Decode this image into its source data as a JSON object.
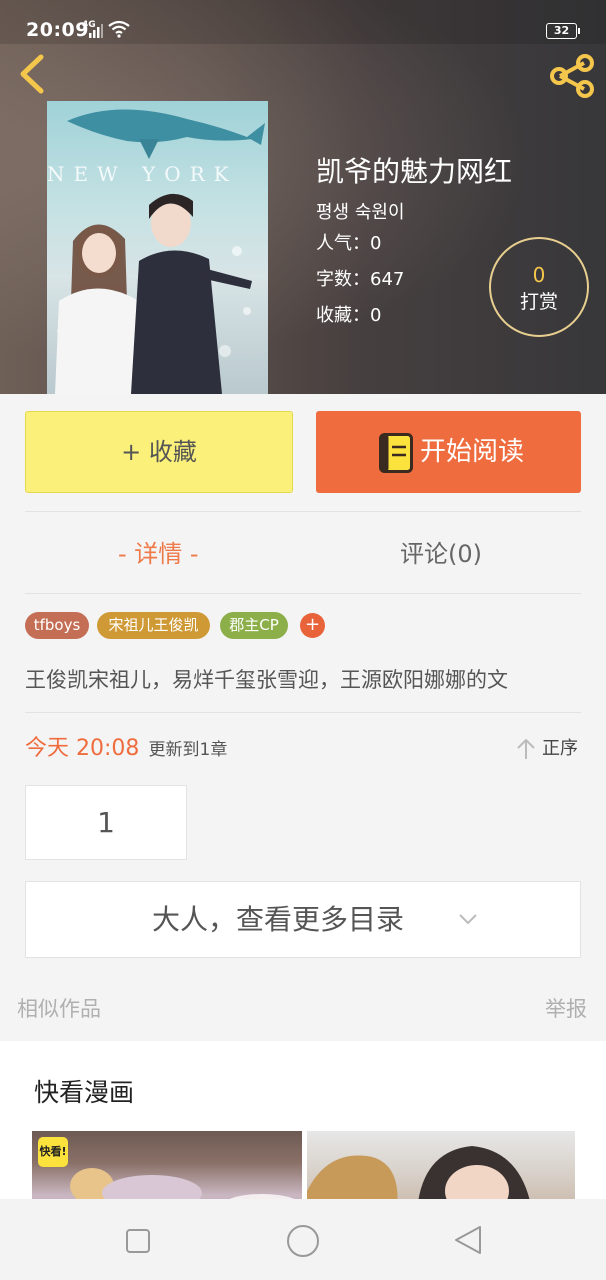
{
  "status_bar": {
    "time": "20:09",
    "network": "4G",
    "battery": "32"
  },
  "book": {
    "title": "凯爷的魅力网红",
    "author": "평생 숙원이",
    "popularity": "人气：0",
    "word_count": "字数：647",
    "favorites": "收藏：0",
    "cover_text": "NEW YORK"
  },
  "reward": {
    "count": "0",
    "label": "打赏"
  },
  "actions": {
    "collect_label": "+ 收藏",
    "read_label": "开始阅读"
  },
  "tabs": [
    {
      "label": "- 详情 -",
      "active": true
    },
    {
      "label": "评论(0)",
      "active": false
    }
  ],
  "tags": [
    "tfboys",
    "宋祖儿王俊凯",
    "郡主CP"
  ],
  "tag_add": "+",
  "synopsis": "王俊凯宋祖儿，易烊千玺张雪迎，王源欧阳娜娜的文",
  "update": {
    "date": "今天 20:08",
    "text": "更新到1章",
    "order_label": "正序"
  },
  "chapters": [
    "1"
  ],
  "more_catalog_label": "大人，查看更多目录",
  "similar_label": "相似作品",
  "report_label": "举报",
  "comics": {
    "title": "快看漫画",
    "badge": "快看!"
  },
  "colors": {
    "accent_orange": "#ee6c3e",
    "collect_yellow": "#fbf17a",
    "reward_gold": "#f4c74c"
  }
}
